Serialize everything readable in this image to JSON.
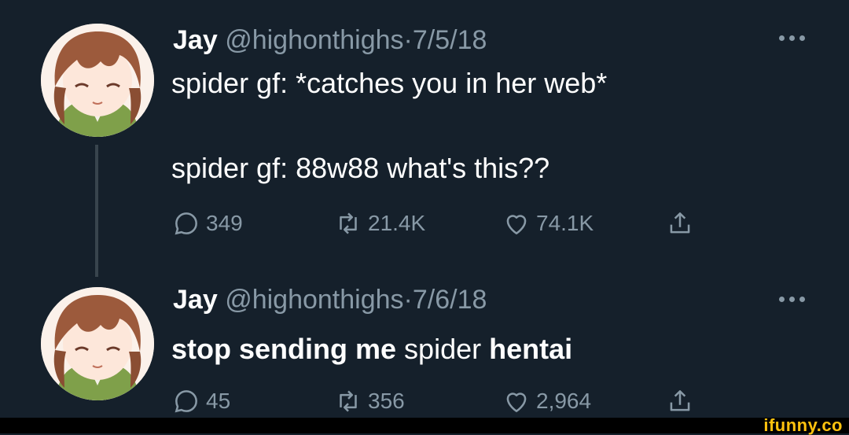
{
  "tweets": [
    {
      "name": "Jay",
      "handle": "@highonthighs",
      "date": "7/5/18",
      "line1": "spider gf: *catches you in her web*",
      "line2": "spider gf: 88w88 what's this??",
      "replies": "349",
      "retweets": "21.4K",
      "likes": "74.1K"
    },
    {
      "name": "Jay",
      "handle": "@highonthighs",
      "date": "7/6/18",
      "text_parts": [
        "stop sending me",
        "spider",
        "hentai"
      ],
      "replies": "45",
      "retweets": "356",
      "likes": "2,964"
    }
  ],
  "separator": "·",
  "icons": {
    "reply": "reply-icon",
    "retweet": "retweet-icon",
    "like": "heart-icon",
    "share": "share-icon",
    "more": "more-icon"
  },
  "colors": {
    "background": "#15202b",
    "secondary_text": "#8899a6",
    "thread_line": "#38444d"
  },
  "watermark": "ifunny.co"
}
